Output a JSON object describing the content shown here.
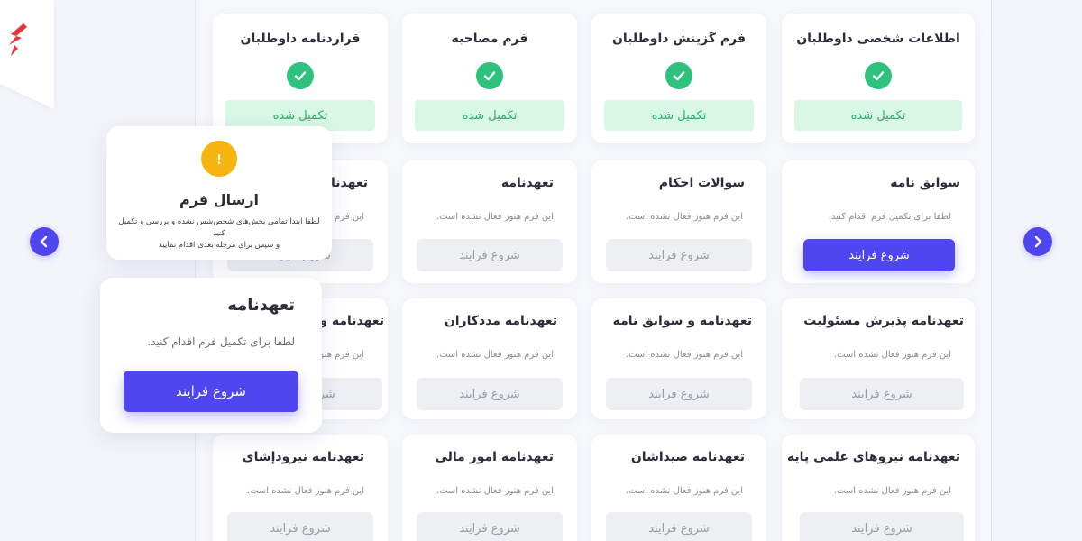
{
  "completed_forms": [
    {
      "title": "اطلاعات شخصی داوطلبان",
      "status": "تکمیل شده"
    },
    {
      "title": "فرم گزینش داوطلبان",
      "status": "تکمیل شده"
    },
    {
      "title": "فرم مصاحبه",
      "status": "تکمیل شده"
    },
    {
      "title": "قراردنامه داوطلبان",
      "status": "تکمیل شده"
    }
  ],
  "forms": [
    [
      {
        "title": "سوابق نامه",
        "subtitle": "لطفا برای تکمیل فرم اقدام کنید.",
        "button": "شروع فرایند",
        "active": true
      },
      {
        "title": "سوالات احکام",
        "subtitle": "این فرم هنوز فعال نشده است.",
        "button": "شروع فرایند",
        "active": false
      },
      {
        "title": "تعهدنامه",
        "subtitle": "این فرم هنوز فعال نشده است.",
        "button": "شروع فرایند",
        "active": false
      },
      {
        "title": "تعهدنامه",
        "subtitle": "این فرم هنوز فعال نشده است.",
        "button": "شروع فرایند",
        "active": false
      }
    ],
    [
      {
        "title": "تعهدنامه پذیرش مسئولیت",
        "subtitle": "این فرم هنوز فعال نشده است.",
        "button": "شروع فرایند",
        "active": false
      },
      {
        "title": "تعهدنامه و سوابق نامه",
        "subtitle": "این فرم هنوز فعال نشده است.",
        "button": "شروع فرایند",
        "active": false
      },
      {
        "title": "تعهدنامه مددکاران",
        "subtitle": "این فرم هنوز فعال نشده است.",
        "button": "شروع فرایند",
        "active": false
      },
      {
        "title": "تعهدنامه و سوابق",
        "subtitle": "این فرم هنوز فعال نشده است.",
        "button": "شروع فرایند",
        "active": false
      }
    ],
    [
      {
        "title": "تعهدنامه نیروهای علمی پایه",
        "subtitle": "این فرم هنوز فعال نشده است.",
        "button": "شروع فرایند",
        "active": false
      },
      {
        "title": "تعهدنامه صیداشان",
        "subtitle": "این فرم هنوز فعال نشده است.",
        "button": "شروع فرایند",
        "active": false
      },
      {
        "title": "تعهدنامه امور مالی",
        "subtitle": "این فرم هنوز فعال نشده است.",
        "button": "شروع فرایند",
        "active": false
      },
      {
        "title": "تعهدنامه نیرودإشای",
        "subtitle": "این فرم هنوز فعال نشده است.",
        "button": "شروع فرایند",
        "active": false
      }
    ]
  ],
  "submit_popup": {
    "title": "ارسال فرم",
    "text_line1": "لطفا ابتدا تمامی بخش‌های شخص‌شس نشده و بررسی و تکمیل کنید",
    "text_line2": "و سپس برای مرحله بعدی اقدام نمایید"
  },
  "zoom_card": {
    "title": "تعهدنامه",
    "subtitle": "لطفا برای تکمیل فرم اقدام کنید.",
    "button": "شروع فرایند"
  },
  "colors": {
    "accent": "#4f46f0",
    "success": "#2ec27e",
    "warning": "#f6b40e",
    "logo": "#e8343a"
  },
  "icons": {
    "prev": "chevron-left-icon",
    "next": "chevron-right-icon",
    "check": "check-icon",
    "warning": "exclamation-icon"
  }
}
